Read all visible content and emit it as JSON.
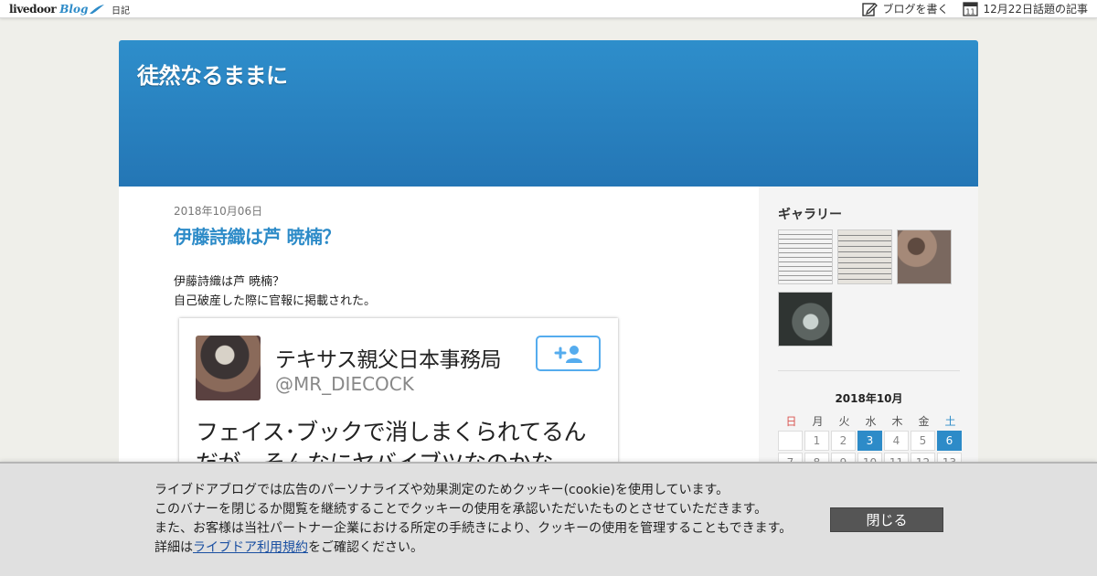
{
  "topbar": {
    "logo_word": "livedoor",
    "logo_blog": "Blog",
    "category": "日記",
    "write_label": "ブログを書く",
    "topics_label": "12月22日話題の記事",
    "calendar_icon_day": "11"
  },
  "blog": {
    "title": "徒然なるままに"
  },
  "post": {
    "date": "2018年10月06日",
    "title": "伊藤詩織は芦 暁楠？",
    "body_line1": "伊藤詩織は芦 暁楠？",
    "body_line2": "自己破産した際に官報に掲載された。",
    "tweet": {
      "name": "テキサス親父日本事務局",
      "handle": "@MR_DIECOCK",
      "text_line1": "フェイス･ブックで消しまくられてるん",
      "text_line2": "だが、そんなにヤバイブツなのかな"
    }
  },
  "sidebar": {
    "gallery_title": "ギャラリー",
    "calendar": {
      "title": "2018年10月",
      "weekdays": [
        "日",
        "月",
        "火",
        "水",
        "木",
        "金",
        "土"
      ],
      "row1": [
        "",
        "1",
        "2",
        "3",
        "4",
        "5",
        "6"
      ],
      "row2": [
        "7",
        "8",
        "9",
        "10",
        "11",
        "12",
        "13"
      ],
      "linked_days": [
        "3",
        "6"
      ]
    }
  },
  "cookie": {
    "line1": "ライブドアブログでは広告のパーソナライズや効果測定のためクッキー(cookie)を使用しています。",
    "line2": "このバナーを閉じるか閲覧を継続することでクッキーの使用を承認いただいたものとさせていただきます。",
    "line3": "また、お客様は当社パートナー企業における所定の手続きにより、クッキーの使用を管理することもできます。",
    "line4_prefix": "詳細は",
    "line4_link": "ライブドア利用規約",
    "line4_suffix": "をご確認ください。",
    "close_label": "閉じる"
  },
  "colors": {
    "accent": "#2d8bc8",
    "header_top": "#2e8ecb",
    "header_bottom": "#2476b5",
    "sunday": "#d9534f",
    "close_button": "#555555"
  }
}
